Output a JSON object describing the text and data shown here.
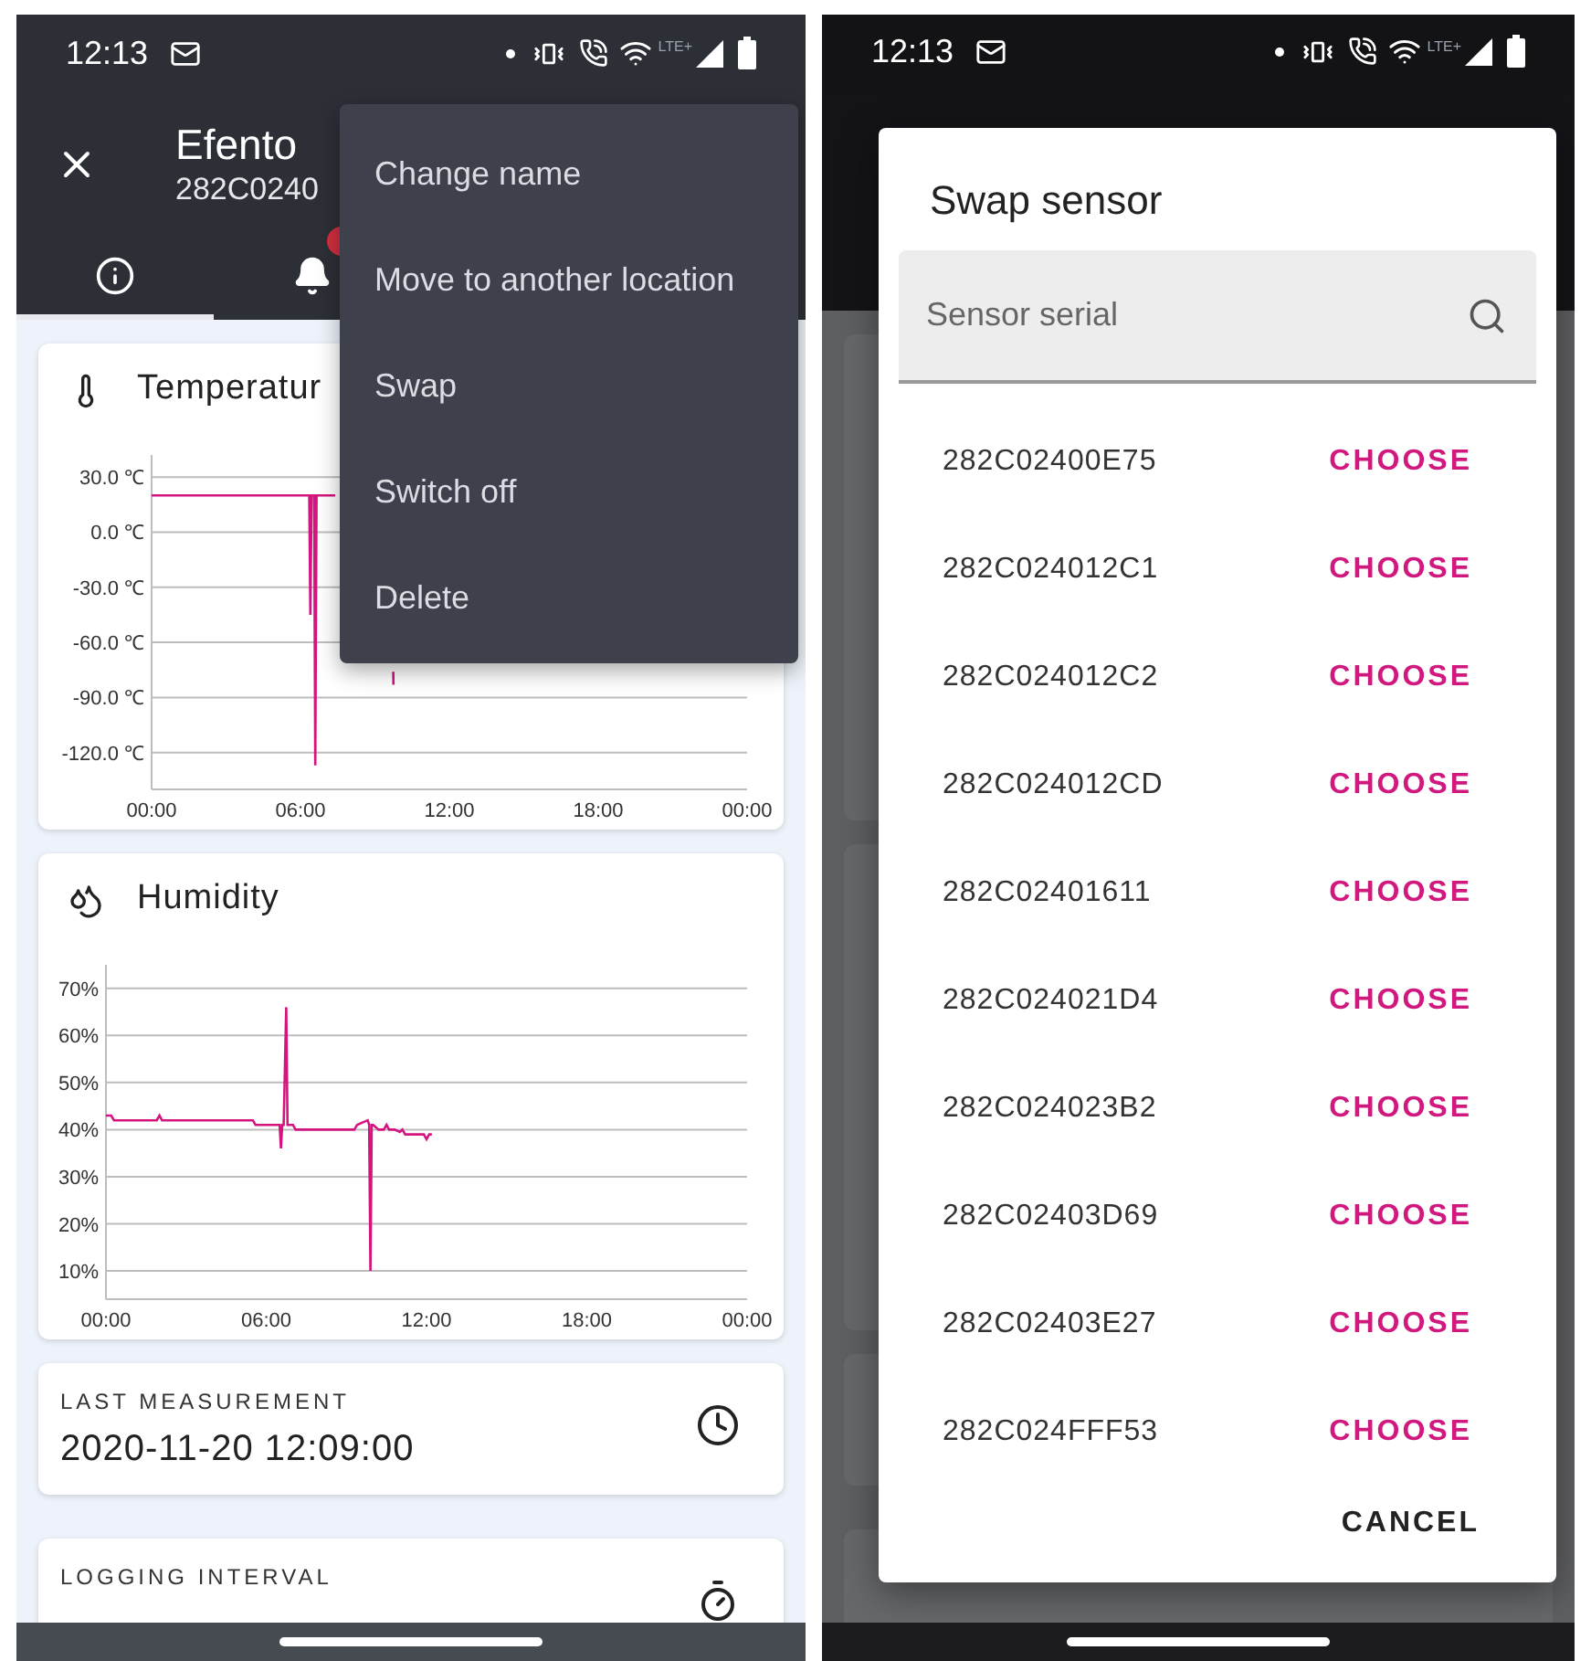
{
  "left_screen": {
    "status_bar": {
      "time": "12:13",
      "network": "LTE+"
    },
    "app_bar": {
      "title": "Efento",
      "subtitle": "282C0240"
    },
    "tabs": [
      {
        "kind": "info",
        "selected": true,
        "badge": false
      },
      {
        "kind": "alerts",
        "selected": false,
        "badge": true
      }
    ],
    "menu": {
      "items": [
        "Change name",
        "Move to another location",
        "Swap",
        "Switch off",
        "Delete"
      ]
    },
    "cards": [
      {
        "kind": "chart",
        "title": "Temperatur",
        "chart_data": {
          "type": "line",
          "grid": true,
          "x": [
            0,
            6.35,
            6.4,
            6.45,
            6.55,
            6.6,
            6.65,
            7.4,
            9.74,
            9.75
          ],
          "series": [
            {
              "color": "#d4157f",
              "values": [
                20,
                20,
                -45,
                20,
                20,
                -127,
                20,
                20,
                null,
                null
              ]
            },
            {
              "color": "#d4157f",
              "values": [
                null,
                null,
                null,
                null,
                null,
                null,
                null,
                null,
                -76,
                -83
              ]
            }
          ],
          "xlim": [
            0,
            24
          ],
          "ylim": [
            -140,
            42
          ],
          "xticks": [
            {
              "value": 0,
              "label": "00:00"
            },
            {
              "value": 6,
              "label": "06:00"
            },
            {
              "value": 12,
              "label": "12:00"
            },
            {
              "value": 18,
              "label": "18:00"
            },
            {
              "value": 24,
              "label": "00:00"
            }
          ],
          "yticks": [
            {
              "value": 30,
              "label": "30.0 ℃"
            },
            {
              "value": 0,
              "label": "0.0 ℃"
            },
            {
              "value": -30,
              "label": "-30.0 ℃"
            },
            {
              "value": -60,
              "label": "-60.0 ℃"
            },
            {
              "value": -90,
              "label": "-90.0 ℃"
            },
            {
              "value": -120,
              "label": "-120.0 ℃"
            }
          ]
        }
      },
      {
        "kind": "chart",
        "title": "Humidity",
        "chart_data": {
          "type": "line",
          "grid": true,
          "x": [
            0,
            0.2,
            0.3,
            1.9,
            2.0,
            2.1,
            5.5,
            5.6,
            6.5,
            6.55,
            6.6,
            6.65,
            6.75,
            6.8,
            6.85,
            7.0,
            7.1,
            9.3,
            9.4,
            9.6,
            9.8,
            9.85,
            9.9,
            9.95,
            10.0,
            10.2,
            10.4,
            10.5,
            10.6,
            10.8,
            11.0,
            11.1,
            11.2,
            11.4,
            11.9,
            12.0,
            12.1,
            12.2
          ],
          "series": [
            {
              "color": "#d4157f",
              "values": [
                43,
                43,
                42,
                42,
                43,
                42,
                42,
                41,
                41,
                36,
                41,
                41,
                66,
                41,
                41,
                41,
                40,
                40,
                41,
                41.5,
                42,
                41,
                10,
                41,
                41,
                40,
                40,
                41,
                40,
                40,
                39.5,
                40,
                39,
                39,
                39,
                38,
                39,
                39
              ]
            }
          ],
          "xlim": [
            0,
            24
          ],
          "ylim": [
            4,
            75
          ],
          "xticks": [
            {
              "value": 0,
              "label": "00:00"
            },
            {
              "value": 6,
              "label": "06:00"
            },
            {
              "value": 12,
              "label": "12:00"
            },
            {
              "value": 18,
              "label": "18:00"
            },
            {
              "value": 24,
              "label": "00:00"
            }
          ],
          "yticks": [
            {
              "value": 70,
              "label": "70%"
            },
            {
              "value": 60,
              "label": "60%"
            },
            {
              "value": 50,
              "label": "50%"
            },
            {
              "value": 40,
              "label": "40%"
            },
            {
              "value": 30,
              "label": "30%"
            },
            {
              "value": 20,
              "label": "20%"
            },
            {
              "value": 10,
              "label": "10%"
            }
          ]
        }
      },
      {
        "kind": "info",
        "label": "LAST MEASUREMENT",
        "value": "2020-11-20 12:09:00"
      },
      {
        "kind": "info",
        "label": "LOGGING INTERVAL"
      }
    ]
  },
  "right_screen": {
    "status_bar": {
      "time": "12:13",
      "network": "LTE+"
    },
    "dialog": {
      "title": "Swap sensor",
      "search": {
        "placeholder": "Sensor serial"
      },
      "options": [
        {
          "serial": "282C02400E75",
          "action": "CHOOSE"
        },
        {
          "serial": "282C024012C1",
          "action": "CHOOSE"
        },
        {
          "serial": "282C024012C2",
          "action": "CHOOSE"
        },
        {
          "serial": "282C024012CD",
          "action": "CHOOSE"
        },
        {
          "serial": "282C02401611",
          "action": "CHOOSE"
        },
        {
          "serial": "282C024021D4",
          "action": "CHOOSE"
        },
        {
          "serial": "282C024023B2",
          "action": "CHOOSE"
        },
        {
          "serial": "282C02403D69",
          "action": "CHOOSE"
        },
        {
          "serial": "282C02403E27",
          "action": "CHOOSE"
        },
        {
          "serial": "282C024FFF53",
          "action": "CHOOSE"
        }
      ],
      "cancel": "CANCEL"
    }
  }
}
